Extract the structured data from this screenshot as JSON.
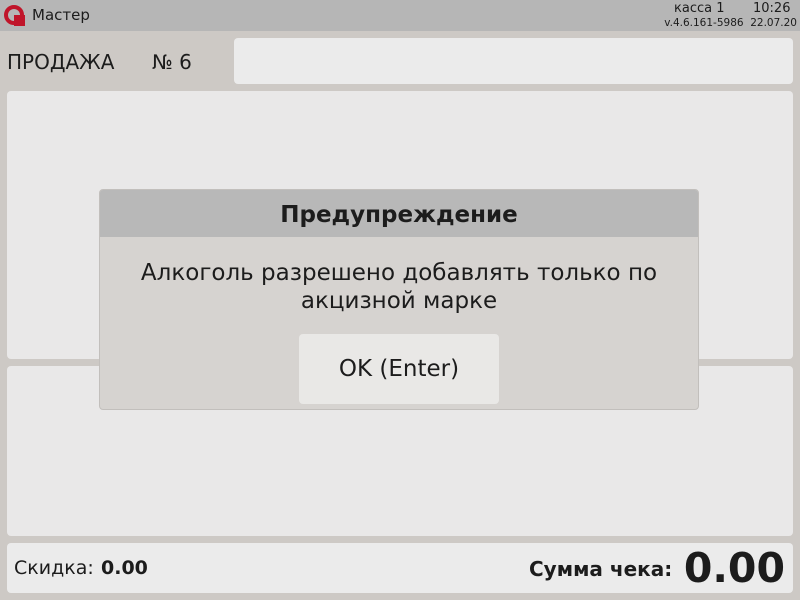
{
  "header": {
    "app_title": "Мастер",
    "register": "касса 1",
    "time": "10:26",
    "version": "v.4.6.161-5986  22.07.20",
    "logo_icon": "logo-icon",
    "brand_color": "#c0152a"
  },
  "sale": {
    "label": "ПРОДАЖА",
    "number": "№ 6",
    "search_value": ""
  },
  "footer": {
    "discount_label": "Скидка:",
    "discount_value": "0.00",
    "total_label": "Сумма чека:",
    "total_value": "0.00"
  },
  "dialog": {
    "title": "Предупреждение",
    "message": "Алкоголь разрешено добавлять только по акцизной марке",
    "ok_label": "OK (Enter)"
  }
}
